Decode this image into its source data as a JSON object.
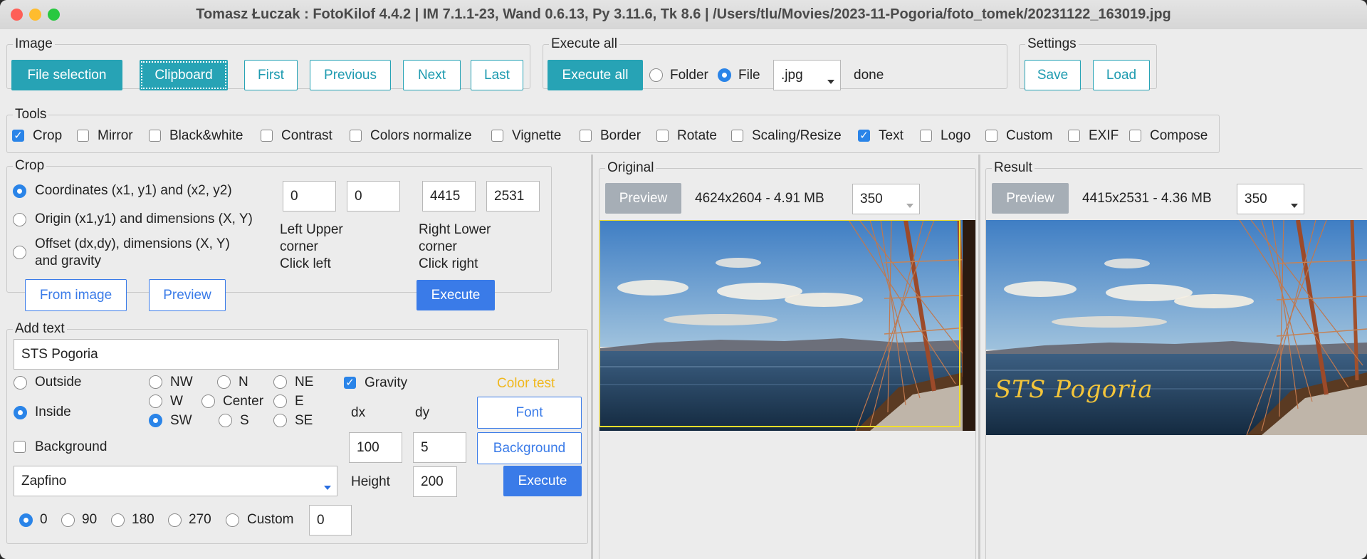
{
  "window": {
    "title": "Tomasz Łuczak : FotoKilof 4.4.2 | IM 7.1.1-23, Wand 0.6.13, Py 3.11.6, Tk 8.6 | /Users/tlu/Movies/2023-11-Pogoria/foto_tomek/20231122_163019.jpg"
  },
  "image_frame": {
    "legend": "Image",
    "file_selection": "File selection",
    "clipboard": "Clipboard",
    "first": "First",
    "previous": "Previous",
    "next": "Next",
    "last": "Last"
  },
  "execute_all_frame": {
    "legend": "Execute all",
    "execute_all": "Execute all",
    "folder": "Folder",
    "file": "File",
    "selected_mode": "File",
    "extension": ".jpg",
    "status": "done"
  },
  "settings_frame": {
    "legend": "Settings",
    "save": "Save",
    "load": "Load"
  },
  "tools_frame": {
    "legend": "Tools",
    "items": [
      {
        "label": "Crop",
        "checked": true
      },
      {
        "label": "Mirror",
        "checked": false
      },
      {
        "label": "Black&white",
        "checked": false
      },
      {
        "label": "Contrast",
        "checked": false
      },
      {
        "label": "Colors normalize",
        "checked": false
      },
      {
        "label": "Vignette",
        "checked": false
      },
      {
        "label": "Border",
        "checked": false
      },
      {
        "label": "Rotate",
        "checked": false
      },
      {
        "label": "Scaling/Resize",
        "checked": false
      },
      {
        "label": "Text",
        "checked": true
      },
      {
        "label": "Logo",
        "checked": false
      },
      {
        "label": "Custom",
        "checked": false
      },
      {
        "label": "EXIF",
        "checked": false
      },
      {
        "label": "Compose",
        "checked": false
      }
    ]
  },
  "crop_frame": {
    "legend": "Crop",
    "option_coords": "Coordinates (x1, y1) and (x2, y2)",
    "option_origin": "Origin (x1,y1) and dimensions (X, Y)",
    "option_offset_line1": "Offset (dx,dy), dimensions (X, Y)",
    "option_offset_line2": "and gravity",
    "selected_option": "Coordinates (x1, y1) and (x2, y2)",
    "x1": "0",
    "y1": "0",
    "x2": "4415",
    "y2": "2531",
    "left_upper_line1": "Left Upper",
    "left_upper_line2": "corner",
    "left_upper_line3": "Click left",
    "right_lower_line1": "Right Lower",
    "right_lower_line2": "corner",
    "right_lower_line3": "Click right",
    "from_image": "From image",
    "preview": "Preview",
    "execute": "Execute"
  },
  "text_frame": {
    "legend": "Add text",
    "text_value": "STS Pogoria",
    "outside": "Outside",
    "inside": "Inside",
    "placement": "Inside",
    "gravity_options": [
      "NW",
      "N",
      "NE",
      "W",
      "Center",
      "E",
      "SW",
      "S",
      "SE"
    ],
    "gravity_selected": "SW",
    "gravity_label": "Gravity",
    "gravity_checked": true,
    "color_test": "Color test",
    "color_test_color": "#f0b81e",
    "dx_label": "dx",
    "dy_label": "dy",
    "dx": "100",
    "dy": "5",
    "font_button": "Font",
    "background_checkbox": "Background",
    "background_button": "Background",
    "font_name": "Zapfino",
    "height_label": "Height",
    "height": "200",
    "execute": "Execute",
    "rotation_options": [
      "0",
      "90",
      "180",
      "270",
      "Custom"
    ],
    "rotation_selected": "0",
    "custom_angle": "0"
  },
  "original_panel": {
    "legend": "Original",
    "preview": "Preview",
    "info": "4624x2604 - 4.91 MB",
    "size": "350"
  },
  "result_panel": {
    "legend": "Result",
    "preview": "Preview",
    "info": "4415x2531 - 4.36 MB",
    "size": "350",
    "overlay_text": "STS Pogoria"
  },
  "colors": {
    "teal_button": "#27a3b5",
    "blue_button": "#3a7be8",
    "grey_button": "#a6aeb6",
    "check_blue": "#2a84e8",
    "overlay_text": "#f3c53a"
  }
}
